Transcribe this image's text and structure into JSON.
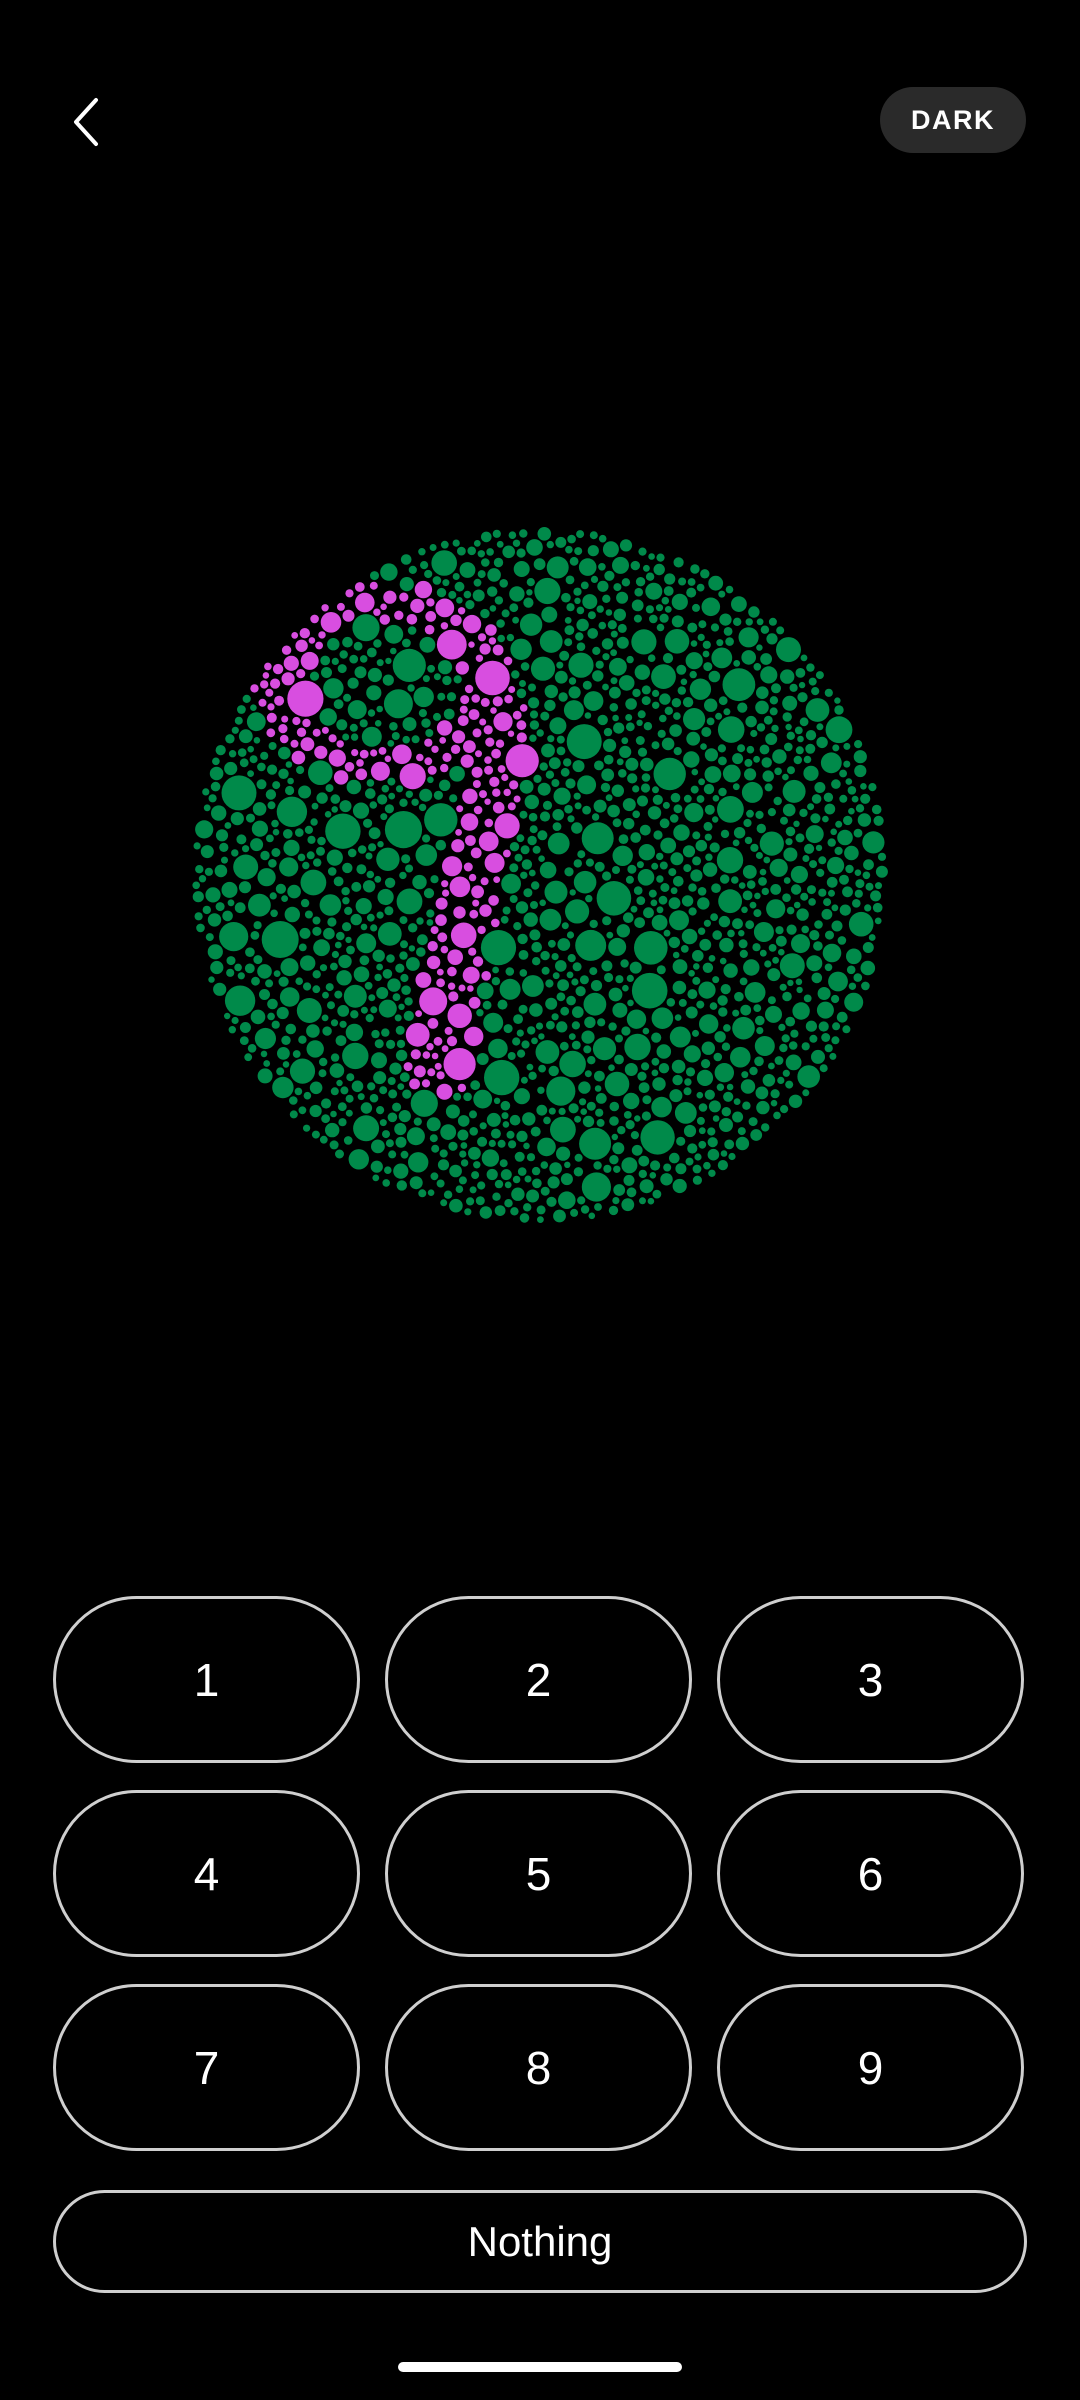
{
  "header": {
    "back_icon": "chevron-left-icon",
    "theme_label": "DARK"
  },
  "plate": {
    "background_dot_color": "#008a4a",
    "figure_dot_color": "#d84ee0",
    "canvas_color": "#000000"
  },
  "answers": {
    "options": [
      "1",
      "2",
      "3",
      "4",
      "5",
      "6",
      "7",
      "8",
      "9"
    ],
    "nothing_label": "Nothing"
  },
  "colors": {
    "background": "#000000",
    "button_border": "#cfcfcf",
    "toggle_background": "#2a2a2a",
    "text": "#ffffff"
  }
}
